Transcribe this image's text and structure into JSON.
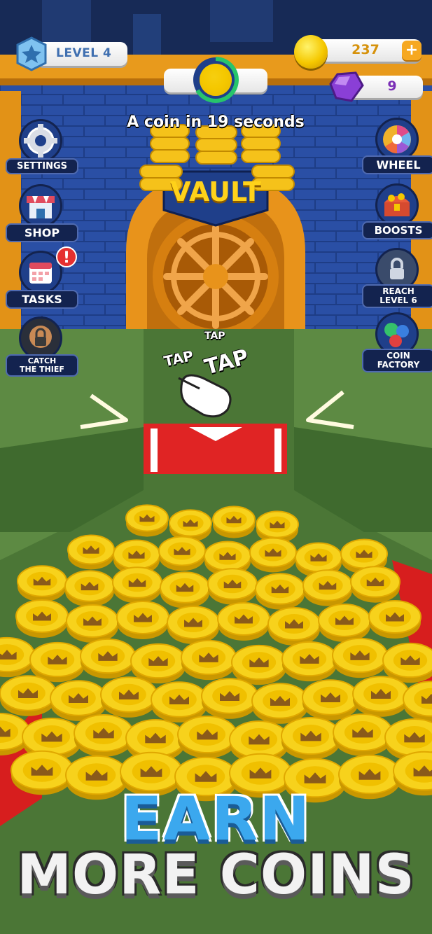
{
  "hud": {
    "level_label": "LEVEL 4",
    "coins": "237",
    "plus": "+",
    "gems": "9",
    "timer_text": "A coin in 19 seconds"
  },
  "vault": {
    "label": "VAULT"
  },
  "tap_hints": [
    "TAP",
    "TAP",
    "TAP"
  ],
  "left_menu": [
    {
      "label": "SETTINGS",
      "icon": "gear-icon"
    },
    {
      "label": "SHOP",
      "icon": "store-icon"
    },
    {
      "label": "TASKS",
      "icon": "calendar-icon",
      "alert": "!"
    },
    {
      "label_line1": "CATCH",
      "label_line2": "THE THIEF",
      "icon": "locked-thief-icon"
    }
  ],
  "right_menu": [
    {
      "label": "WHEEL",
      "icon": "prize-wheel-icon"
    },
    {
      "label": "BOOSTS",
      "icon": "treasure-chest-icon"
    },
    {
      "label_line1": "REACH",
      "label_line2": "LEVEL 6",
      "icon": "lock-icon"
    },
    {
      "label_line1": "COIN",
      "label_line2": "FACTORY",
      "icon": "gears-icon"
    }
  ],
  "headline": {
    "line1": "EARN",
    "line2": "MORE COINS"
  },
  "colors": {
    "coin": "#f5c800",
    "gem": "#8a3fd6",
    "wall": "#1f3f8a",
    "floor": "#4c7a35",
    "headline_blue": "#3ba8ee"
  }
}
